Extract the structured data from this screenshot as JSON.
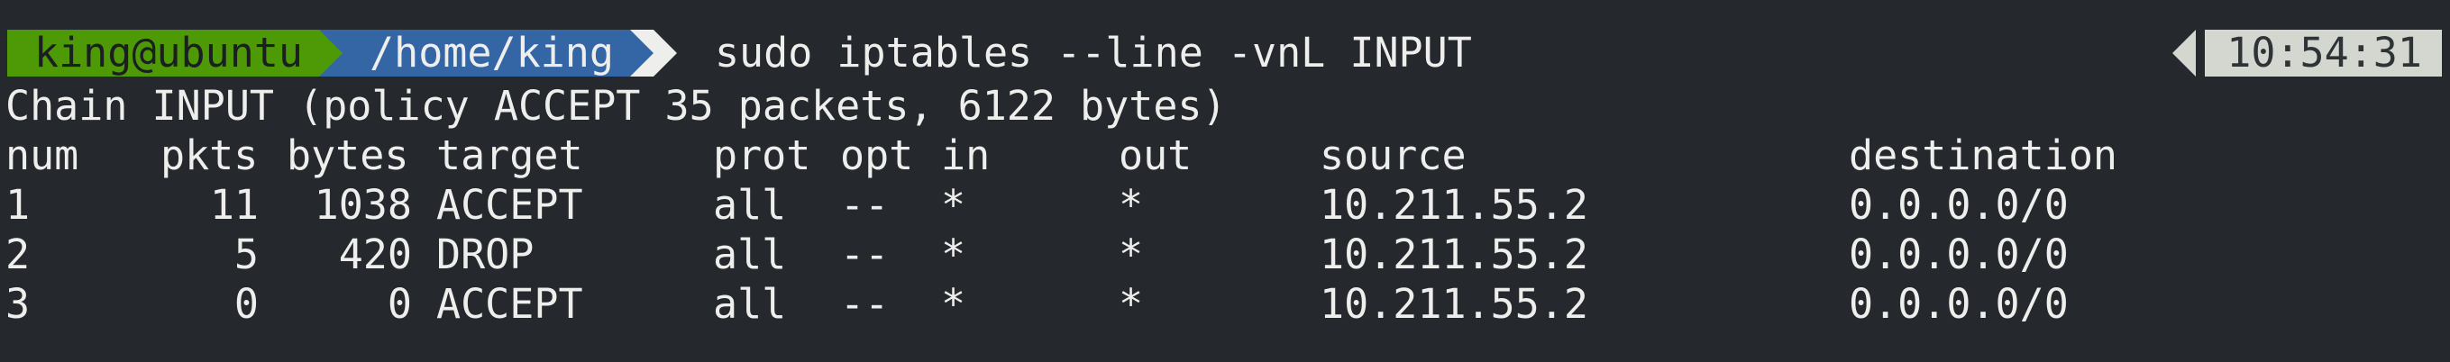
{
  "prompt": {
    "user_host": "king@ubuntu",
    "path": "/home/king",
    "command": "sudo iptables --line -vnL INPUT",
    "time": "10:54:31"
  },
  "output": {
    "chain_line": "Chain INPUT (policy ACCEPT 35 packets, 6122 bytes)",
    "headers": [
      "num",
      "pkts",
      "bytes",
      "target",
      "prot",
      "opt",
      "in",
      "out",
      "source",
      "destination"
    ],
    "rows": [
      [
        "1",
        "11",
        "1038",
        "ACCEPT",
        "all",
        "--",
        "*",
        "*",
        "10.211.55.2",
        "0.0.0.0/0"
      ],
      [
        "2",
        "5",
        "420",
        "DROP",
        "all",
        "--",
        "*",
        "*",
        "10.211.55.2",
        "0.0.0.0/0"
      ],
      [
        "3",
        "0",
        "0",
        "ACCEPT",
        "all",
        "--",
        "*",
        "*",
        "10.211.55.2",
        "0.0.0.0/0"
      ]
    ]
  },
  "colors": {
    "background": "#25282c",
    "user_segment": "#4e9a06",
    "path_segment": "#3465a4",
    "time_segment": "#d3d7cf",
    "text": "#eeeeec"
  }
}
